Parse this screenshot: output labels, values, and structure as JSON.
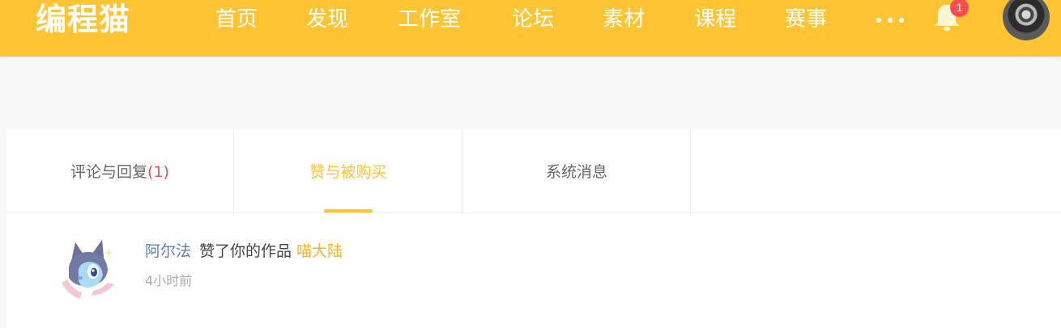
{
  "header": {
    "logo": "编程猫",
    "nav": [
      "首页",
      "发现",
      "工作室",
      "论坛",
      "素材",
      "课程",
      "赛事"
    ],
    "more_icon": "more-dots-icon",
    "notification_icon": "bell-icon",
    "notification_count": "1",
    "brand_color": "#ffc433"
  },
  "tabs": [
    {
      "label": "评论与回复",
      "count": "(1)"
    },
    {
      "label": "赞与被购买",
      "active": true
    },
    {
      "label": "系统消息"
    }
  ],
  "messages": [
    {
      "user": "阿尔法",
      "action": "赞了你的作品",
      "work": "喵大陆",
      "time": "4小时前"
    }
  ]
}
